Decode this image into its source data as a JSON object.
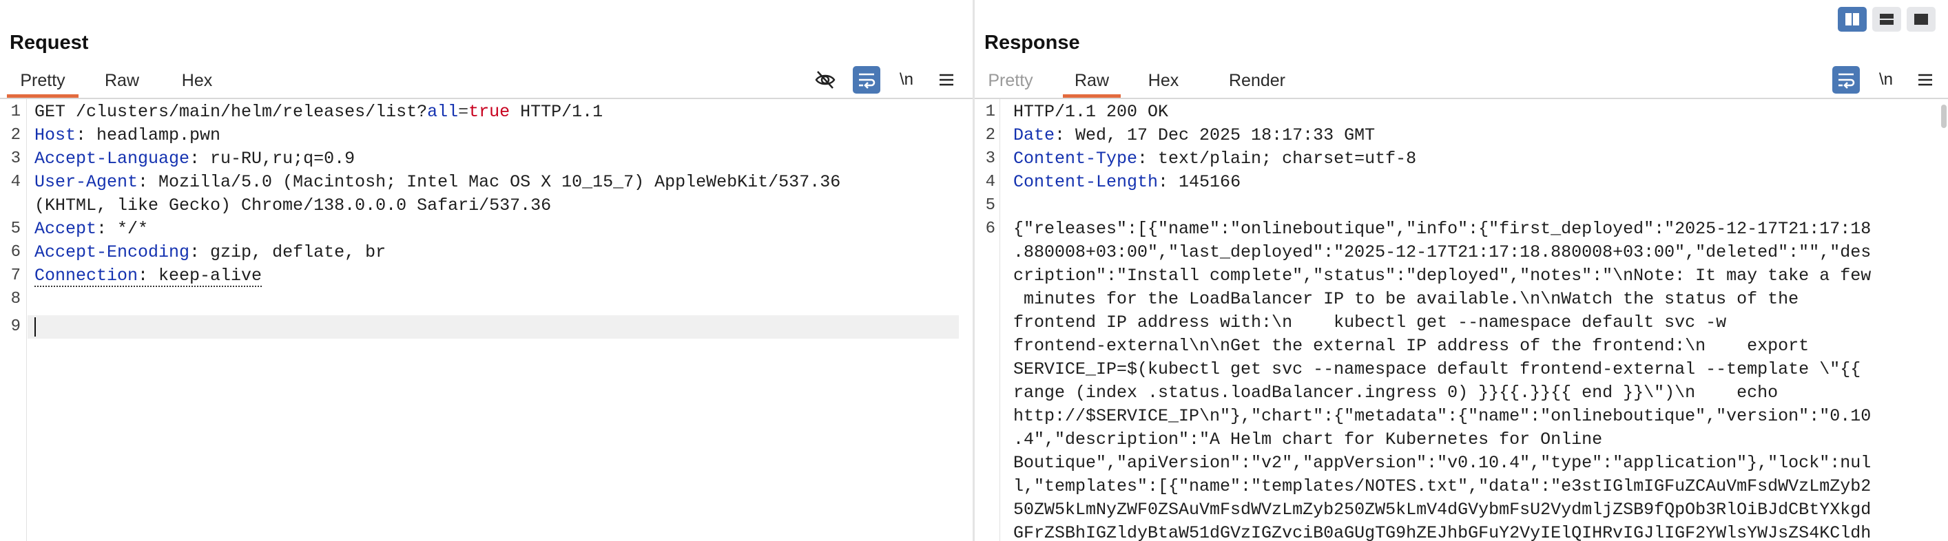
{
  "request": {
    "title": "Request",
    "tabs": [
      {
        "label": "Pretty",
        "active": true
      },
      {
        "label": "Raw",
        "active": false
      },
      {
        "label": "Hex",
        "active": false
      }
    ],
    "toolbar": {
      "newline_label": "\\n",
      "hide_icon": "eye-off-icon",
      "wrap_icon": "wrap-icon",
      "menu_icon": "menu-icon"
    },
    "lines": [
      {
        "num": "1",
        "method_path": "GET /clusters/main/helm/releases/list?",
        "param": "all",
        "eq": "=",
        "val": "true",
        "proto": " HTTP/1.1"
      },
      {
        "num": "2",
        "key": "Host",
        "value": ": headlamp.pwn"
      },
      {
        "num": "3",
        "key": "Accept-Language",
        "value": ": ru-RU,ru;q=0.9"
      },
      {
        "num": "4",
        "key": "User-Agent",
        "value": ": Mozilla/5.0 (Macintosh; Intel Mac OS X 10_15_7) AppleWebKit/537.36",
        "cont": "(KHTML, like Gecko) Chrome/138.0.0.0 Safari/537.36"
      },
      {
        "num": "5",
        "key": "Accept",
        "value": ": */*"
      },
      {
        "num": "6",
        "key": "Accept-Encoding",
        "value": ": gzip, deflate, br"
      },
      {
        "num": "7",
        "key": "Connection",
        "value": ": keep-alive"
      },
      {
        "num": "8"
      },
      {
        "num": "9"
      }
    ]
  },
  "response": {
    "title": "Response",
    "tabs": [
      {
        "label": "Pretty",
        "active": false,
        "disabled": true
      },
      {
        "label": "Raw",
        "active": true
      },
      {
        "label": "Hex",
        "active": false
      },
      {
        "label": "Render",
        "active": false
      }
    ],
    "toolbar": {
      "newline_label": "\\n",
      "wrap_icon": "wrap-icon",
      "menu_icon": "menu-icon"
    },
    "headers": [
      {
        "num": "1",
        "text": "HTTP/1.1 200 OK"
      },
      {
        "num": "2",
        "key": "Date",
        "value": ": Wed, 17 Dec 2025 18:17:33 GMT"
      },
      {
        "num": "3",
        "key": "Content-Type",
        "value": ": text/plain; charset=utf-8"
      },
      {
        "num": "4",
        "key": "Content-Length",
        "value": ": 145166"
      },
      {
        "num": "5"
      },
      {
        "num": "6"
      }
    ],
    "body_lines": [
      "{\"releases\":[{\"name\":\"onlineboutique\",\"info\":{\"first_deployed\":\"2025-12-17T21:17:18",
      ".880008+03:00\",\"last_deployed\":\"2025-12-17T21:17:18.880008+03:00\",\"deleted\":\"\",\"des",
      "cription\":\"Install complete\",\"status\":\"deployed\",\"notes\":\"\\nNote: It may take a few",
      " minutes for the LoadBalancer IP to be available.\\n\\nWatch the status of the",
      "frontend IP address with:\\n    kubectl get --namespace default svc -w",
      "frontend-external\\n\\nGet the external IP address of the frontend:\\n    export",
      "SERVICE_IP=$(kubectl get svc --namespace default frontend-external --template \\\"{{",
      "range (index .status.loadBalancer.ingress 0) }}{{.}}{{ end }}\\\")\\n    echo",
      "http://$SERVICE_IP\\n\"},\"chart\":{\"metadata\":{\"name\":\"onlineboutique\",\"version\":\"0.10",
      ".4\",\"description\":\"A Helm chart for Kubernetes for Online",
      "Boutique\",\"apiVersion\":\"v2\",\"appVersion\":\"v0.10.4\",\"type\":\"application\"},\"lock\":nul",
      "l,\"templates\":[{\"name\":\"templates/NOTES.txt\",\"data\":\"e3stIGlmIGFuZCAuVmFsdWVzLmZyb2",
      "50ZW5kLmNyZWF0ZSAuVmFsdWVzLmZyb250ZW5kLmV4dGVybmFsU2VydmljZSB9fQpOb3RlOiBJdCBtYXkgd",
      "GFrZSBhIGZldyBtaW51dGVzIGZvciB0aGUgTG9hZEJhbGFuY2VyIElQIHRvIGJlIGF2YWlsYWJsZS4KCldh"
    ]
  },
  "layout_switcher": {
    "icons": [
      "split-columns-icon",
      "split-rows-icon",
      "single-pane-icon"
    ],
    "active_index": 0
  }
}
